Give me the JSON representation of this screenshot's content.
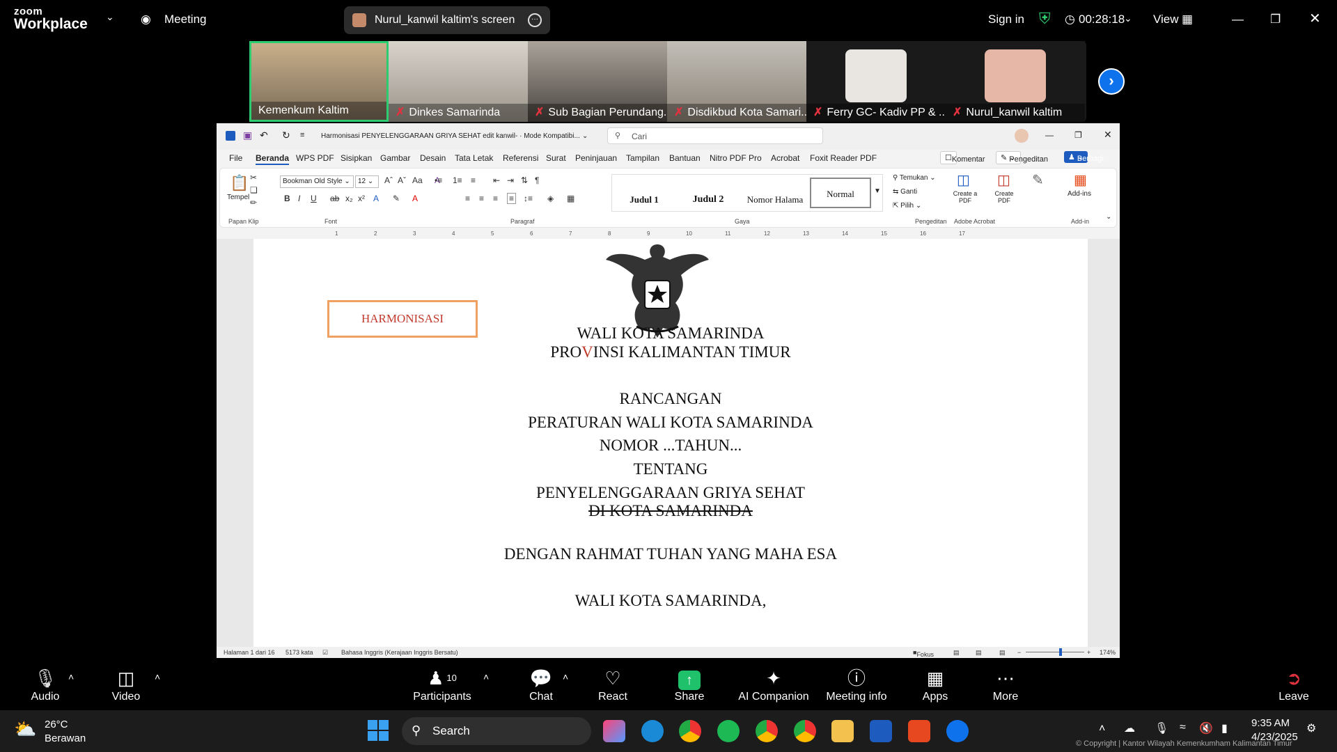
{
  "zoom": {
    "brand_line1": "zoom",
    "brand_line2": "Workplace",
    "meeting_label": "Meeting",
    "screen_share_label": "Nurul_kanwil kaltim's screen",
    "sign_in": "Sign in",
    "timer": "00:28:18",
    "view_label": "View"
  },
  "participants": [
    {
      "name": "Kemenkum Kaltim",
      "muted": false
    },
    {
      "name": "Dinkes Samarinda",
      "muted": true
    },
    {
      "name": "Sub Bagian Perundang...",
      "muted": true
    },
    {
      "name": "Disdikbud Kota Samari...",
      "muted": true
    },
    {
      "name": "Ferry GC- Kadiv PP & ...",
      "muted": true
    },
    {
      "name": "Nurul_kanwil kaltim",
      "muted": true
    }
  ],
  "word": {
    "doc_title": "Harmonisasi PENYELENGGARAAN GRIYA SEHAT edit kanwil- · Mode Kompatibi...",
    "search_placeholder": "Cari",
    "menu": [
      "File",
      "Beranda",
      "WPS PDF",
      "Sisipkan",
      "Gambar",
      "Desain",
      "Tata Letak",
      "Referensi",
      "Surat",
      "Peninjauan",
      "Tampilan",
      "Bantuan",
      "Nitro PDF Pro",
      "Acrobat",
      "Foxit Reader PDF"
    ],
    "komentar": "Komentar",
    "pengeditan": "Pengeditan",
    "berbagi": "Berbagi",
    "font_name": "Bookman Old Style",
    "font_size": "12",
    "tempel": "Tempel",
    "groups": {
      "papan_klip": "Papan Klip",
      "font": "Font",
      "paragraf": "Paragraf",
      "gaya": "Gaya",
      "pengeditan": "Pengeditan",
      "adobe": "Adobe Acrobat",
      "addin": "Add-in"
    },
    "styles": [
      "Judul 1",
      "Judul 2",
      "Nomor Halama",
      "Normal"
    ],
    "edit_tools": [
      "Temukan",
      "Ganti",
      "Pilih"
    ],
    "create_a_pdf": "Create a PDF",
    "create_pdf": "Create PDF",
    "add_ins": "Add-ins",
    "document": {
      "harmonisasi": "HARMONISASI",
      "line1": "WALI KOTA SAMARINDA",
      "line2_a": "PRO",
      "line2_b": "V",
      "line2_c": "INSI KALIMANTAN TIMUR",
      "line3": "RANCANGAN",
      "line4": "PERATURAN WALI KOTA SAMARINDA",
      "line5": "NOMOR ...TAHUN...",
      "line6": "TENTANG",
      "line7": "PENYELENGGARAAN GRIYA SEHAT",
      "line8": "DI KOTA SAMARINDA",
      "line9": "DENGAN RAHMAT TUHAN YANG MAHA ESA",
      "line10": "WALI KOTA SAMARINDA,"
    },
    "status": {
      "page": "Halaman 1 dari 16",
      "words": "5173 kata",
      "language": "Bahasa Inggris (Kerajaan Inggris Bersatu)",
      "focus": "Fokus",
      "zoom": "174%"
    }
  },
  "controls": {
    "audio": "Audio",
    "video": "Video",
    "participants": "Participants",
    "participants_count": "10",
    "chat": "Chat",
    "react": "React",
    "share": "Share",
    "ai": "AI Companion",
    "meeting_info": "Meeting info",
    "apps": "Apps",
    "more": "More",
    "leave": "Leave"
  },
  "taskbar": {
    "temp": "26°C",
    "weather": "Berawan",
    "search": "Search",
    "time": "9:35 AM",
    "date": "4/23/2025",
    "copyright": "© Copyright | Kantor Wilayah Kemenkumham Kalimantan Timur"
  },
  "colors": {
    "zoom_blue": "#0e72ed",
    "active_green": "#2ecc71",
    "share_green": "#1fc16b",
    "mute_red": "#e0323f",
    "word_blue": "#1e5bbf"
  }
}
